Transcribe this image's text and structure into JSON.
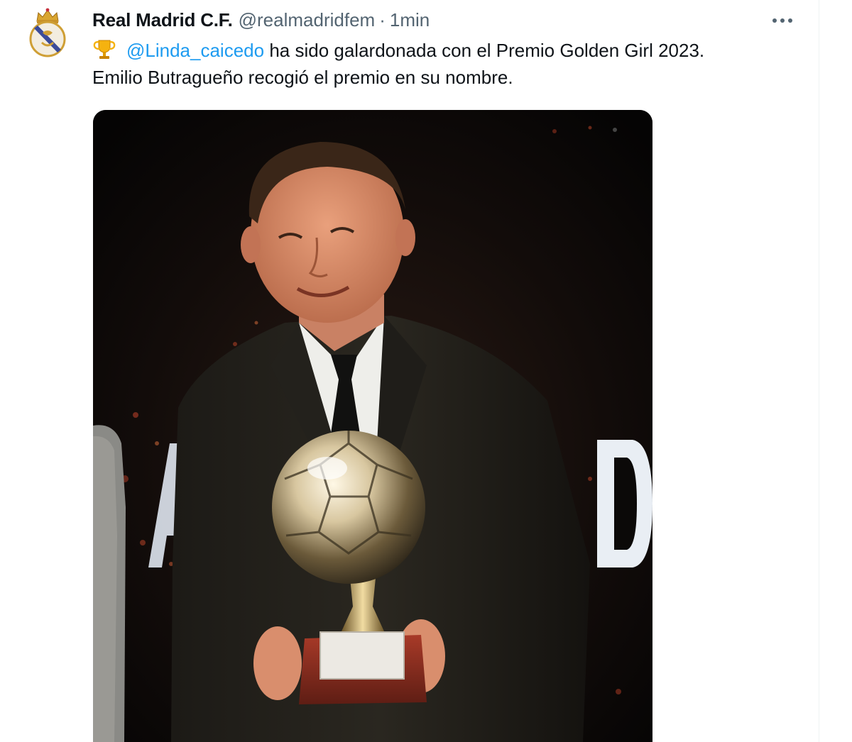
{
  "tweet": {
    "author_name": "Real Madrid C.F.",
    "author_handle": "@realmadridfem",
    "separator": "·",
    "time": "1min",
    "more_icon": "more-horizontal-icon",
    "avatar_icon": "real-madrid-crest-icon",
    "trophy_icon": "trophy-emoji-icon",
    "mention": "@Linda_caicedo",
    "text_line1_rest": " ha sido galardonada con el Premio Golden Girl 2023.",
    "text_line2": "Emilio Butragueño recogió el premio en su nombre."
  },
  "colors": {
    "text": "#0f1419",
    "secondary": "#536471",
    "link": "#1d9bf0",
    "divider": "#eff3f4"
  }
}
